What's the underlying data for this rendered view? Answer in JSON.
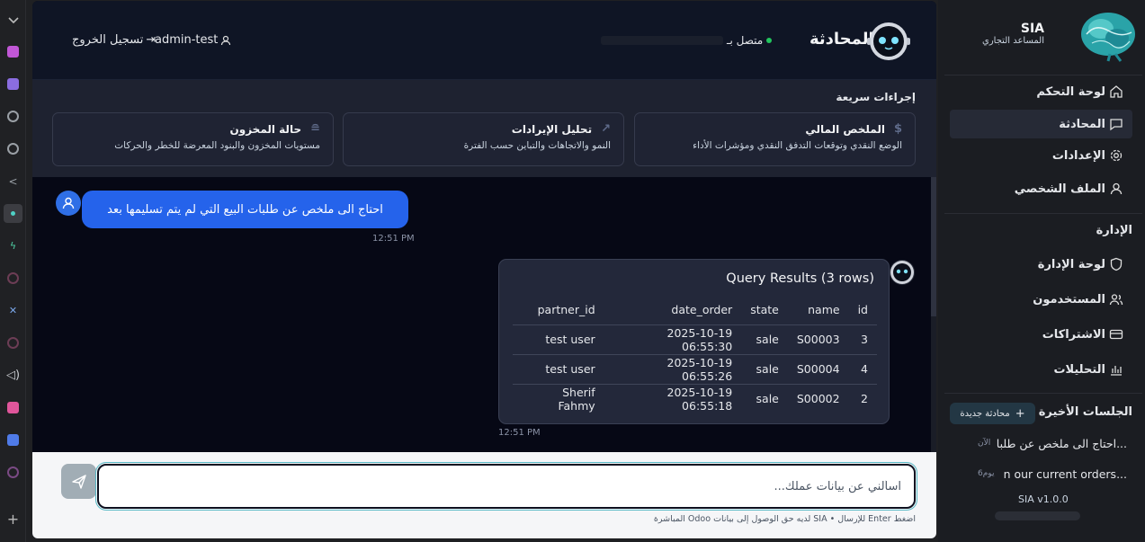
{
  "topbar": {
    "logout_label": "تسجيل الخروج",
    "username": "admin-test",
    "connection_status": "متصل بـ",
    "chat_title": "المحادثة"
  },
  "quick_actions": {
    "title": "إجراءات سريعة",
    "cards": [
      {
        "title": "الملخص المالي",
        "desc": "الوضع النقدي وتوقعات التدفق النقدي ومؤشرات الأداء",
        "icon": "dollar-icon"
      },
      {
        "title": "تحليل الإيرادات",
        "desc": "النمو والاتجاهات والتباين حسب الفترة",
        "icon": "trending-up-icon"
      },
      {
        "title": "حالة المخزون",
        "desc": "مستويات المخزون والبنود المعرضة للخطر والحركات",
        "icon": "database-icon"
      }
    ]
  },
  "messages": {
    "user_message": "احتاج الى ملخص عن طلبات البيع التي لم يتم تسليمها بعد",
    "user_time": "12:51 PM",
    "result_title": "Query Results (3 rows)",
    "result_time": "12:51 PM",
    "columns": [
      "partner_id",
      "date_order",
      "state",
      "name",
      "id"
    ],
    "rows": [
      [
        "test user",
        "2025-10-19 06:55:30",
        "sale",
        "S00003",
        "3"
      ],
      [
        "test user",
        "2025-10-19 06:55:26",
        "sale",
        "S00004",
        "4"
      ],
      [
        "Sherif Fahmy",
        "2025-10-19 06:55:18",
        "sale",
        "S00002",
        "2"
      ]
    ]
  },
  "input": {
    "placeholder": "اسألني عن بيانات عملك...",
    "hint": "اضغط Enter للإرسال • SIA لديه حق الوصول إلى بيانات Odoo المباشرة"
  },
  "sidebar": {
    "brand_name": "SIA",
    "brand_subtitle": "المساعد التجاري",
    "nav": [
      {
        "label": "لوحة التحكم",
        "icon": "home-icon"
      },
      {
        "label": "المحادثة",
        "icon": "chat-icon"
      },
      {
        "label": "الإعدادات",
        "icon": "gear-icon"
      },
      {
        "label": "الملف الشخصي",
        "icon": "user-icon"
      }
    ],
    "admin_section": "الإدارة",
    "admin_nav": [
      {
        "label": "لوحة الإدارة",
        "icon": "shield-icon"
      },
      {
        "label": "المستخدمون",
        "icon": "users-icon"
      },
      {
        "label": "الاشتراكات",
        "icon": "card-icon"
      },
      {
        "label": "التحليلات",
        "icon": "bar-chart-icon"
      }
    ],
    "recent_section": "الجلسات الأخيرة",
    "new_chat_label": "محادثة جديدة",
    "sessions": [
      {
        "title": "احتاج الى ملخص عن طلبا...",
        "time": "الآن"
      },
      {
        "title": "n our current orders...",
        "time": "6يوم"
      }
    ],
    "version": "SIA v1.0.0"
  },
  "colors": {
    "accent_blue": "#2563eb",
    "online_green": "#22c55e",
    "panel": "#23283a"
  }
}
